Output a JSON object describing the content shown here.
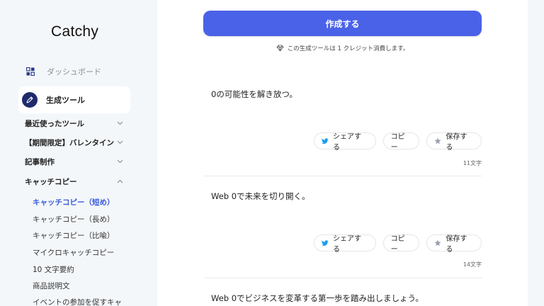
{
  "app": {
    "logo": "Catchy"
  },
  "sidebar": {
    "dashboard_label": "ダッシュボード",
    "tools_label": "生成ツール",
    "categories": [
      {
        "label": "最近使ったツール",
        "expanded": false
      },
      {
        "label": "【期間限定】バレンタイン",
        "expanded": false
      },
      {
        "label": "記事制作",
        "expanded": false
      },
      {
        "label": "キャッチコピー",
        "expanded": true
      }
    ],
    "subitems": [
      {
        "label": "キャッチコピー（短め）",
        "active": true
      },
      {
        "label": "キャッチコピー（長め）",
        "active": false
      },
      {
        "label": "キャッチコピー（比喩）",
        "active": false
      },
      {
        "label": "マイクロキャッチコピー",
        "active": false
      },
      {
        "label": "10 文字要約",
        "active": false
      },
      {
        "label": "商品説明文",
        "active": false
      },
      {
        "label": "イベントの参加を促すキャ",
        "active": false
      }
    ]
  },
  "main": {
    "create_button": "作成する",
    "credit_note": "この生成ツールは 1 クレジット消費します。",
    "share_label": "シェアする",
    "copy_label": "コピー",
    "save_label": "保存する",
    "results": [
      {
        "text": "0の可能性を解き放つ。",
        "count": "11文字"
      },
      {
        "text": "Web 0で未来を切り開く。",
        "count": "14文字"
      },
      {
        "text": "Web 0でビジネスを変革する第一歩を踏み出しましょう。",
        "count": ""
      }
    ]
  },
  "colors": {
    "accent": "#4a62e8",
    "active_text": "#3a5bd9",
    "tools_icon_bg": "#1f2a6b"
  }
}
